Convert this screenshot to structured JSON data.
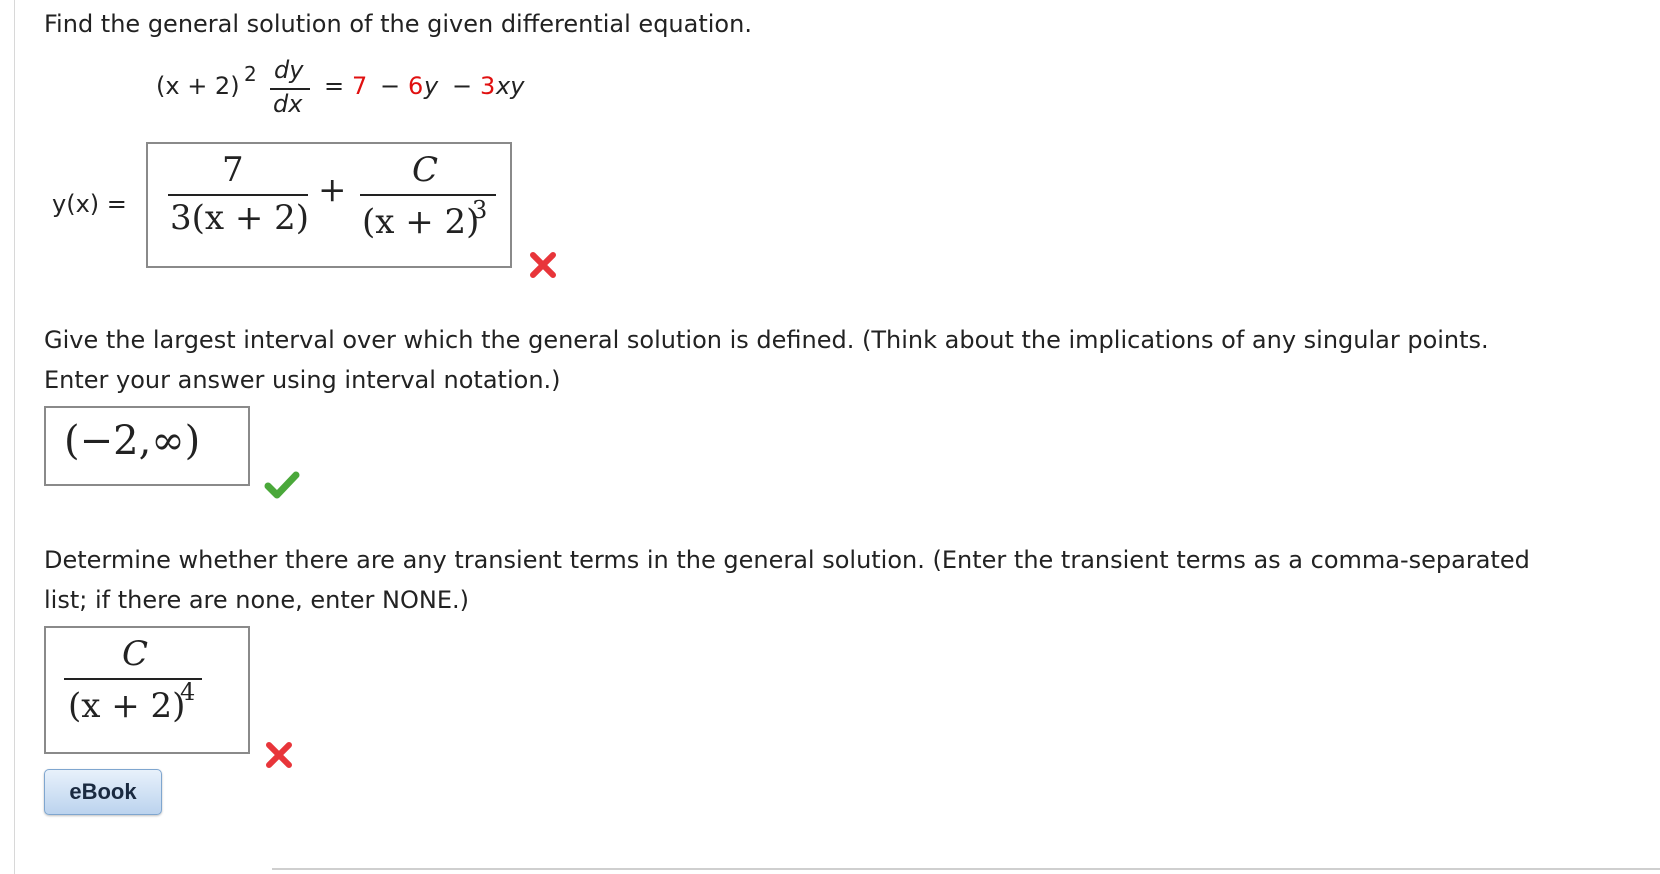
{
  "q1": {
    "prompt": "Find the general solution of the given differential equation.",
    "equation": {
      "lhs": "(x + 2)",
      "lhs_exp": "2",
      "dy": "dy",
      "dx": "dx",
      "equals": "=",
      "rhs_7": "7",
      "minus1": "−",
      "rhs_6": "6",
      "rhs_y": "y",
      "minus2": "−",
      "rhs_3": "3",
      "rhs_xy": "xy"
    },
    "answer_label": "y(x) =",
    "answer": {
      "num1": "7",
      "den1": "3(x + 2)",
      "plus": "+",
      "num2": "C",
      "den2": "(x + 2)",
      "den2_exp": "3"
    },
    "status": "incorrect"
  },
  "q2": {
    "prompt_line1": "Give the largest interval over which the general solution is defined. (Think about the implications of any singular points.",
    "prompt_line2": "Enter your answer using interval notation.)",
    "answer": "(−2,∞)",
    "status": "correct"
  },
  "q3": {
    "prompt_line1": "Determine whether there are any transient terms in the general solution. (Enter the transient terms as a comma-separated",
    "prompt_line2": "list; if there are none, enter NONE.)",
    "answer": {
      "num": "C",
      "den": "(x + 2)",
      "den_exp": "4"
    },
    "status": "incorrect"
  },
  "buttons": {
    "ebook": "eBook"
  },
  "colors": {
    "coefficient_red": "#e01010",
    "incorrect_mark": "#e8353a",
    "correct_mark": "#4aa83a",
    "box_border": "#8a8a8a"
  }
}
